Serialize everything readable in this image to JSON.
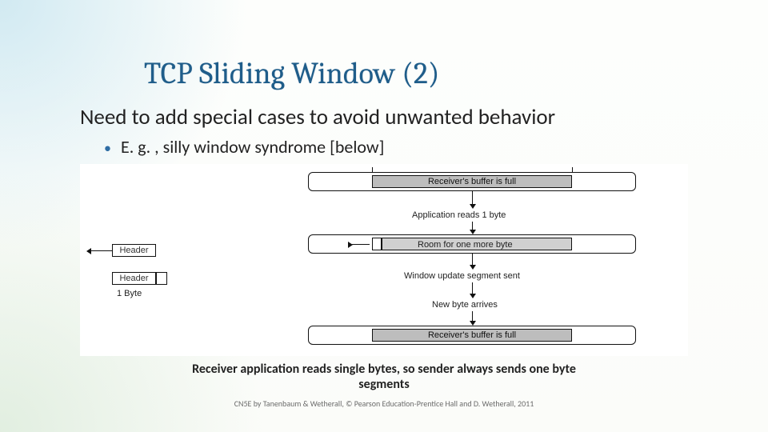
{
  "title": "TCP Sliding Window (2)",
  "body": "Need to add special cases to avoid unwanted behavior",
  "bullet": "E. g. , silly window syndrome [below]",
  "diagram": {
    "left_header1": "Header",
    "left_header2": "Header",
    "left_one_byte": "1 Byte",
    "buf_full_top": "Receiver's buffer is full",
    "app_reads": "Application reads 1 byte",
    "room": "Room for one more byte",
    "win_update": "Window update segment sent",
    "new_byte": "New byte arrives",
    "buf_full_bot": "Receiver's buffer is full"
  },
  "caption": "Receiver application reads single bytes, so sender always sends one byte segments",
  "footer": "CN5E by Tanenbaum & Wetherall, © Pearson Education-Prentice Hall and D. Wetherall, 2011"
}
